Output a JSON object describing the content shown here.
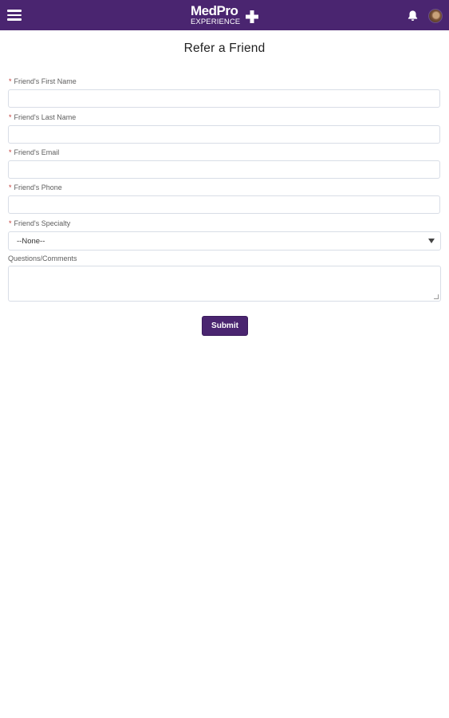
{
  "header": {
    "logo_line1": "MedPro",
    "logo_line2": "EXPERIENCE",
    "bg_color": "#4a2570"
  },
  "page": {
    "title": "Refer a Friend"
  },
  "form": {
    "required_marker": "*",
    "first_name": {
      "label": "Friend's First Name",
      "value": ""
    },
    "last_name": {
      "label": "Friend's Last Name",
      "value": ""
    },
    "email": {
      "label": "Friend's Email",
      "value": ""
    },
    "phone": {
      "label": "Friend's Phone",
      "value": ""
    },
    "specialty": {
      "label": "Friend's Specialty",
      "selected": "--None--"
    },
    "comments": {
      "label": "Questions/Comments",
      "value": ""
    },
    "submit_label": "Submit"
  },
  "icons": {
    "menu": "hamburger-menu-icon",
    "bell": "bell-icon",
    "avatar": "user-avatar",
    "dropdown": "chevron-down-icon"
  },
  "colors": {
    "brand": "#4a2570",
    "required": "#c23934",
    "border": "#d8dde6"
  }
}
